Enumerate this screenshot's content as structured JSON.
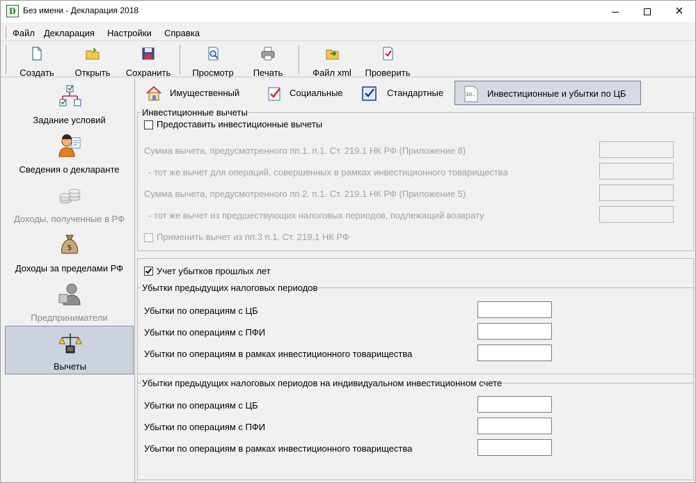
{
  "window": {
    "icon_letter": "D",
    "title": "Без имени - Декларация 2018",
    "controls": {
      "minimize": "minimize-icon",
      "maximize": "maximize-icon",
      "close": "×"
    }
  },
  "menu": [
    "Файл",
    "Декларация",
    "Настройки",
    "Справка"
  ],
  "toolbar": [
    {
      "label": "Создать",
      "icon": "new-document-icon"
    },
    {
      "label": "Открыть",
      "icon": "open-folder-icon"
    },
    {
      "label": "Сохранить",
      "icon": "save-disk-icon"
    },
    {
      "label": "Просмотр",
      "icon": "preview-icon"
    },
    {
      "label": "Печать",
      "icon": "printer-icon"
    },
    {
      "label": "Файл xml",
      "icon": "xml-file-icon"
    },
    {
      "label": "Проверить",
      "icon": "check-document-icon"
    }
  ],
  "nav": [
    {
      "label": "Задание условий",
      "icon": "conditions-tree-icon",
      "state": "normal"
    },
    {
      "label": "Сведения о декларанте",
      "icon": "person-icon",
      "state": "normal"
    },
    {
      "label": "Доходы, полученные в РФ",
      "icon": "coins-icon",
      "state": "disabled"
    },
    {
      "label": "Доходы за пределами РФ",
      "icon": "money-bag-icon",
      "state": "normal"
    },
    {
      "label": "Предприниматели",
      "icon": "entrepreneur-icon",
      "state": "disabled"
    },
    {
      "label": "Вычеты",
      "icon": "scales-icon",
      "state": "active"
    }
  ],
  "tabs": [
    {
      "label": "Имущественный",
      "icon": "house-icon"
    },
    {
      "label": "Социальные",
      "icon": "checklist-icon"
    },
    {
      "label": "Стандартные",
      "icon": "standard-check-icon"
    },
    {
      "label": "Инвестиционные и убытки по ЦБ",
      "icon": "investment-doc-icon",
      "icon_text": "20..",
      "active": true
    }
  ],
  "investment_group": {
    "caption": "Инвестиционные вычеты",
    "provide_checkbox": {
      "label": "Предоставить инвестиционные вычеты",
      "checked": false
    },
    "rows": [
      "Сумма вычета, предусмотренного пп.1. п.1. Ст. 219.1 НК РФ (Приложение 8)",
      "- тот же вычет для операций, совершенных в рамках инвестиционного товарищества",
      "Сумма вычета, предусмотренного пп.2. п.1. Ст. 219.1 НК РФ (Приложение 5)",
      "- тот же вычет из предшествующих налоговых периодов, подлежащий возврату"
    ],
    "apply_checkbox": {
      "label": "Применить вычет из пп.3 п.1. Ст. 219.1 НК РФ",
      "checked": false
    }
  },
  "losses": {
    "checkbox": {
      "label": "Учет убытков прошлых лет",
      "checked": true
    },
    "group1": {
      "caption": "Убытки предыдущих налоговых периодов",
      "rows": [
        {
          "label": "Убытки по операциям с ЦБ",
          "value": ""
        },
        {
          "label": "Убытки по операциям с ПФИ",
          "value": ""
        },
        {
          "label": "Убытки по операциям в рамках инвестиционного товарищества",
          "value": ""
        }
      ]
    },
    "group2": {
      "caption": "Убытки предыдущих налоговых периодов на индивидуальном инвестиционном счете",
      "rows": [
        {
          "label": "Убытки по операциям с ЦБ",
          "value": ""
        },
        {
          "label": "Убытки по операциям с ПФИ",
          "value": ""
        },
        {
          "label": "Убытки по операциям в рамках инвестиционного товарищества",
          "value": ""
        }
      ]
    }
  }
}
